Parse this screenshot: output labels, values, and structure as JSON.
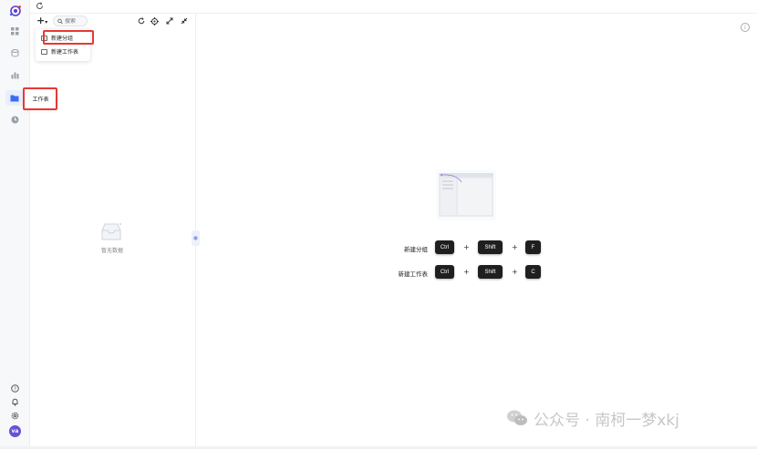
{
  "topbar": {
    "refresh_icon": "refresh-icon"
  },
  "rail": {
    "logo": "app-logo",
    "items": [
      {
        "name": "grid",
        "icon": "grid-icon"
      },
      {
        "name": "database",
        "icon": "database-icon"
      },
      {
        "name": "chart",
        "icon": "chart-icon"
      },
      {
        "name": "folder",
        "icon": "folder-icon",
        "active": true
      },
      {
        "name": "clock",
        "icon": "clock-icon"
      }
    ],
    "bottom": [
      {
        "name": "help",
        "icon": "help-icon"
      },
      {
        "name": "notifications",
        "icon": "bell-icon"
      },
      {
        "name": "settings",
        "icon": "gear-icon"
      }
    ],
    "avatar_text": "va",
    "tooltip": "工作表"
  },
  "panel": {
    "add_label": "+",
    "search_placeholder": "搜索",
    "tools": [
      "refresh-icon",
      "locate-icon",
      "expand-icon",
      "collapse-icon"
    ],
    "dropdown": [
      {
        "label": "新建分组",
        "icon": "folder-add-icon"
      },
      {
        "label": "新建工作表",
        "icon": "sheet-add-icon"
      }
    ],
    "empty_text": "暂无数据"
  },
  "main": {
    "shortcuts": [
      {
        "label": "新建分组",
        "keys": [
          "Ctrl",
          "Shift",
          "F"
        ]
      },
      {
        "label": "新建工作表",
        "keys": [
          "Ctrl",
          "Shift",
          "C"
        ]
      }
    ],
    "plus": "+"
  },
  "watermark": "公众号 · 南柯一梦xkj",
  "colors": {
    "accent": "#3d6bf0",
    "highlight": "#e53935",
    "key_bg": "#1f1f1f",
    "avatar_bg": "#6a4fd6"
  }
}
